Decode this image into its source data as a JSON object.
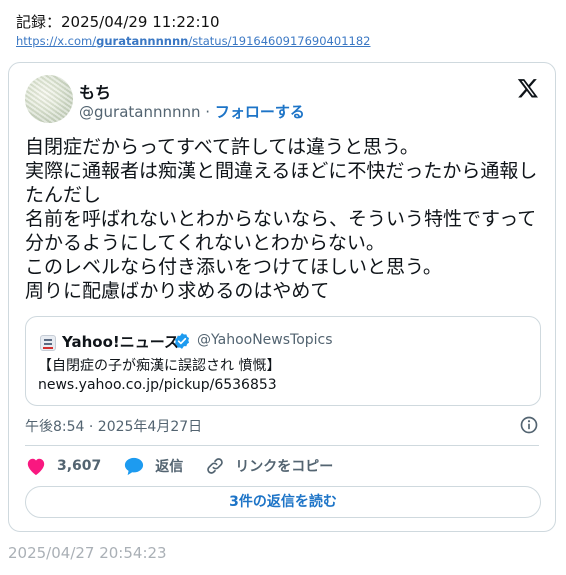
{
  "record": {
    "label": "記録：2025/04/29 11:22:10",
    "url_prefix": "https://x.com/",
    "url_user": "guratannnnnn",
    "url_suffix": "/status/1916460917690401182"
  },
  "tweet": {
    "display_name": "もち",
    "handle": "@guratannnnnn",
    "separator": " · ",
    "follow_label": "フォローする",
    "text": "自閉症だからってすべて許しては違うと思う。\n実際に通報者は痴漢と間違えるほどに不快だったから通報したんだし\n名前を呼ばれないとわからないなら、そういう特性ですって分かるようにしてくれないとわからない。\nこのレベルなら付き添いをつけてほしいと思う。\n周りに配慮ばかり求めるのはやめて",
    "timestamp": "午後8:54 · 2025年4月27日",
    "likes": "3,607",
    "reply_label": "返信",
    "copy_link_label": "リンクをコピー",
    "read_replies_label": "3件の返信を読む"
  },
  "quote": {
    "name": "Yahoo!ニュース",
    "handle": "@YahooNewsTopics",
    "title": "【自閉症の子が痴漢に誤認され 憤慨】",
    "link": "news.yahoo.co.jp/pickup/6536853"
  },
  "footer": {
    "time": "2025/04/27 20:54:23"
  },
  "colors": {
    "accent": "#1d74c7",
    "like": "#f91880",
    "reply": "#1d9bf0",
    "border": "#cfd9de",
    "muted": "#536471"
  },
  "icons": [
    "x-logo-icon",
    "verified-badge-icon",
    "info-icon",
    "heart-icon",
    "reply-bubble-icon",
    "link-icon",
    "yahoo-news-icon"
  ]
}
